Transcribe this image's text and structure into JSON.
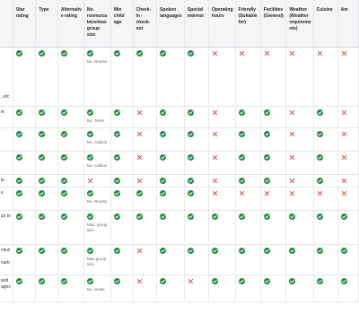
{
  "colors": {
    "check": "#1e8a3c",
    "cross": "#d63a3a",
    "header_bg": "#f4f5f7"
  },
  "icons": {
    "yes": "check-circle-icon",
    "no": "x-icon"
  },
  "headers": [
    "",
    "Star rating",
    "Type",
    "Alternativ e rating",
    "No. rooms/ca bins/max group size",
    "Min child age",
    "Check-in - check-out",
    "Spoken languages",
    "Special interest",
    "Operating hours",
    "Friendly (Suitable for)",
    "Facilities (General)",
    "Weather (Weather requireme nts)",
    "Cuisine",
    "Am"
  ],
  "rows": [
    {
      "label": [
        "",
        "",
        "",
        "",
        "",
        "",
        "",
        ", etc"
      ],
      "note_col": 4,
      "note": "No. Rooms",
      "cells": [
        "y",
        "y",
        "y",
        "y",
        "y",
        "y",
        "y",
        "y",
        "n",
        "n",
        "n",
        "n",
        "n",
        "n"
      ]
    },
    {
      "label": [
        "le"
      ],
      "note_col": 4,
      "note": "No. Tents",
      "cells": [
        "y",
        "y",
        "y",
        "y",
        "y",
        "n",
        "y",
        "y",
        "n",
        "y",
        "y",
        "n",
        "y",
        "n"
      ]
    },
    {
      "label": [
        ""
      ],
      "note_col": 4,
      "note": "No. Cabins",
      "cells": [
        "y",
        "y",
        "y",
        "y",
        "y",
        "n",
        "y",
        "y",
        "n",
        "y",
        "y",
        "n",
        "y",
        "n"
      ]
    },
    {
      "label": [
        ""
      ],
      "note_col": 4,
      "note": "No. Cabins",
      "cells": [
        "y",
        "y",
        "y",
        "y",
        "y",
        "n",
        "y",
        "y",
        "n",
        "y",
        "y",
        "n",
        "y",
        "n"
      ]
    },
    {
      "label": [
        "le"
      ],
      "note_col": 4,
      "note": "",
      "cells": [
        "y",
        "y",
        "y",
        "n",
        "y",
        "n",
        "y",
        "y",
        "n",
        "y",
        "y",
        "n",
        "y",
        "n"
      ]
    },
    {
      "label": [
        "e"
      ],
      "note_col": 4,
      "note": "No. Rooms",
      "cells": [
        "y",
        "y",
        "y",
        "y",
        "y",
        "y",
        "y",
        "y",
        "n",
        "n",
        "n",
        "n",
        "n",
        "n"
      ]
    },
    {
      "label": [
        "ps to"
      ],
      "note_col": 4,
      "note": "Max. group size",
      "cells": [
        "y",
        "y",
        "y",
        "y",
        "y",
        "y",
        "y",
        "y",
        "y",
        "y",
        "y",
        "y",
        "y",
        "y"
      ]
    },
    {
      "label": [
        "ction",
        "",
        "nark"
      ],
      "note_col": 4,
      "note": "Max group size",
      "cells": [
        "y",
        "y",
        "y",
        "y",
        "y",
        "n",
        "y",
        "y",
        "y",
        "y",
        "y",
        "y",
        "y",
        "y"
      ]
    },
    {
      "label": [
        "and",
        "ages"
      ],
      "note_col": 4,
      "note": "No. Seats",
      "cells": [
        "y",
        "y",
        "y",
        "y",
        "y",
        "n",
        "y",
        "n",
        "y",
        "y",
        "y",
        "y",
        "y",
        "y"
      ]
    }
  ]
}
